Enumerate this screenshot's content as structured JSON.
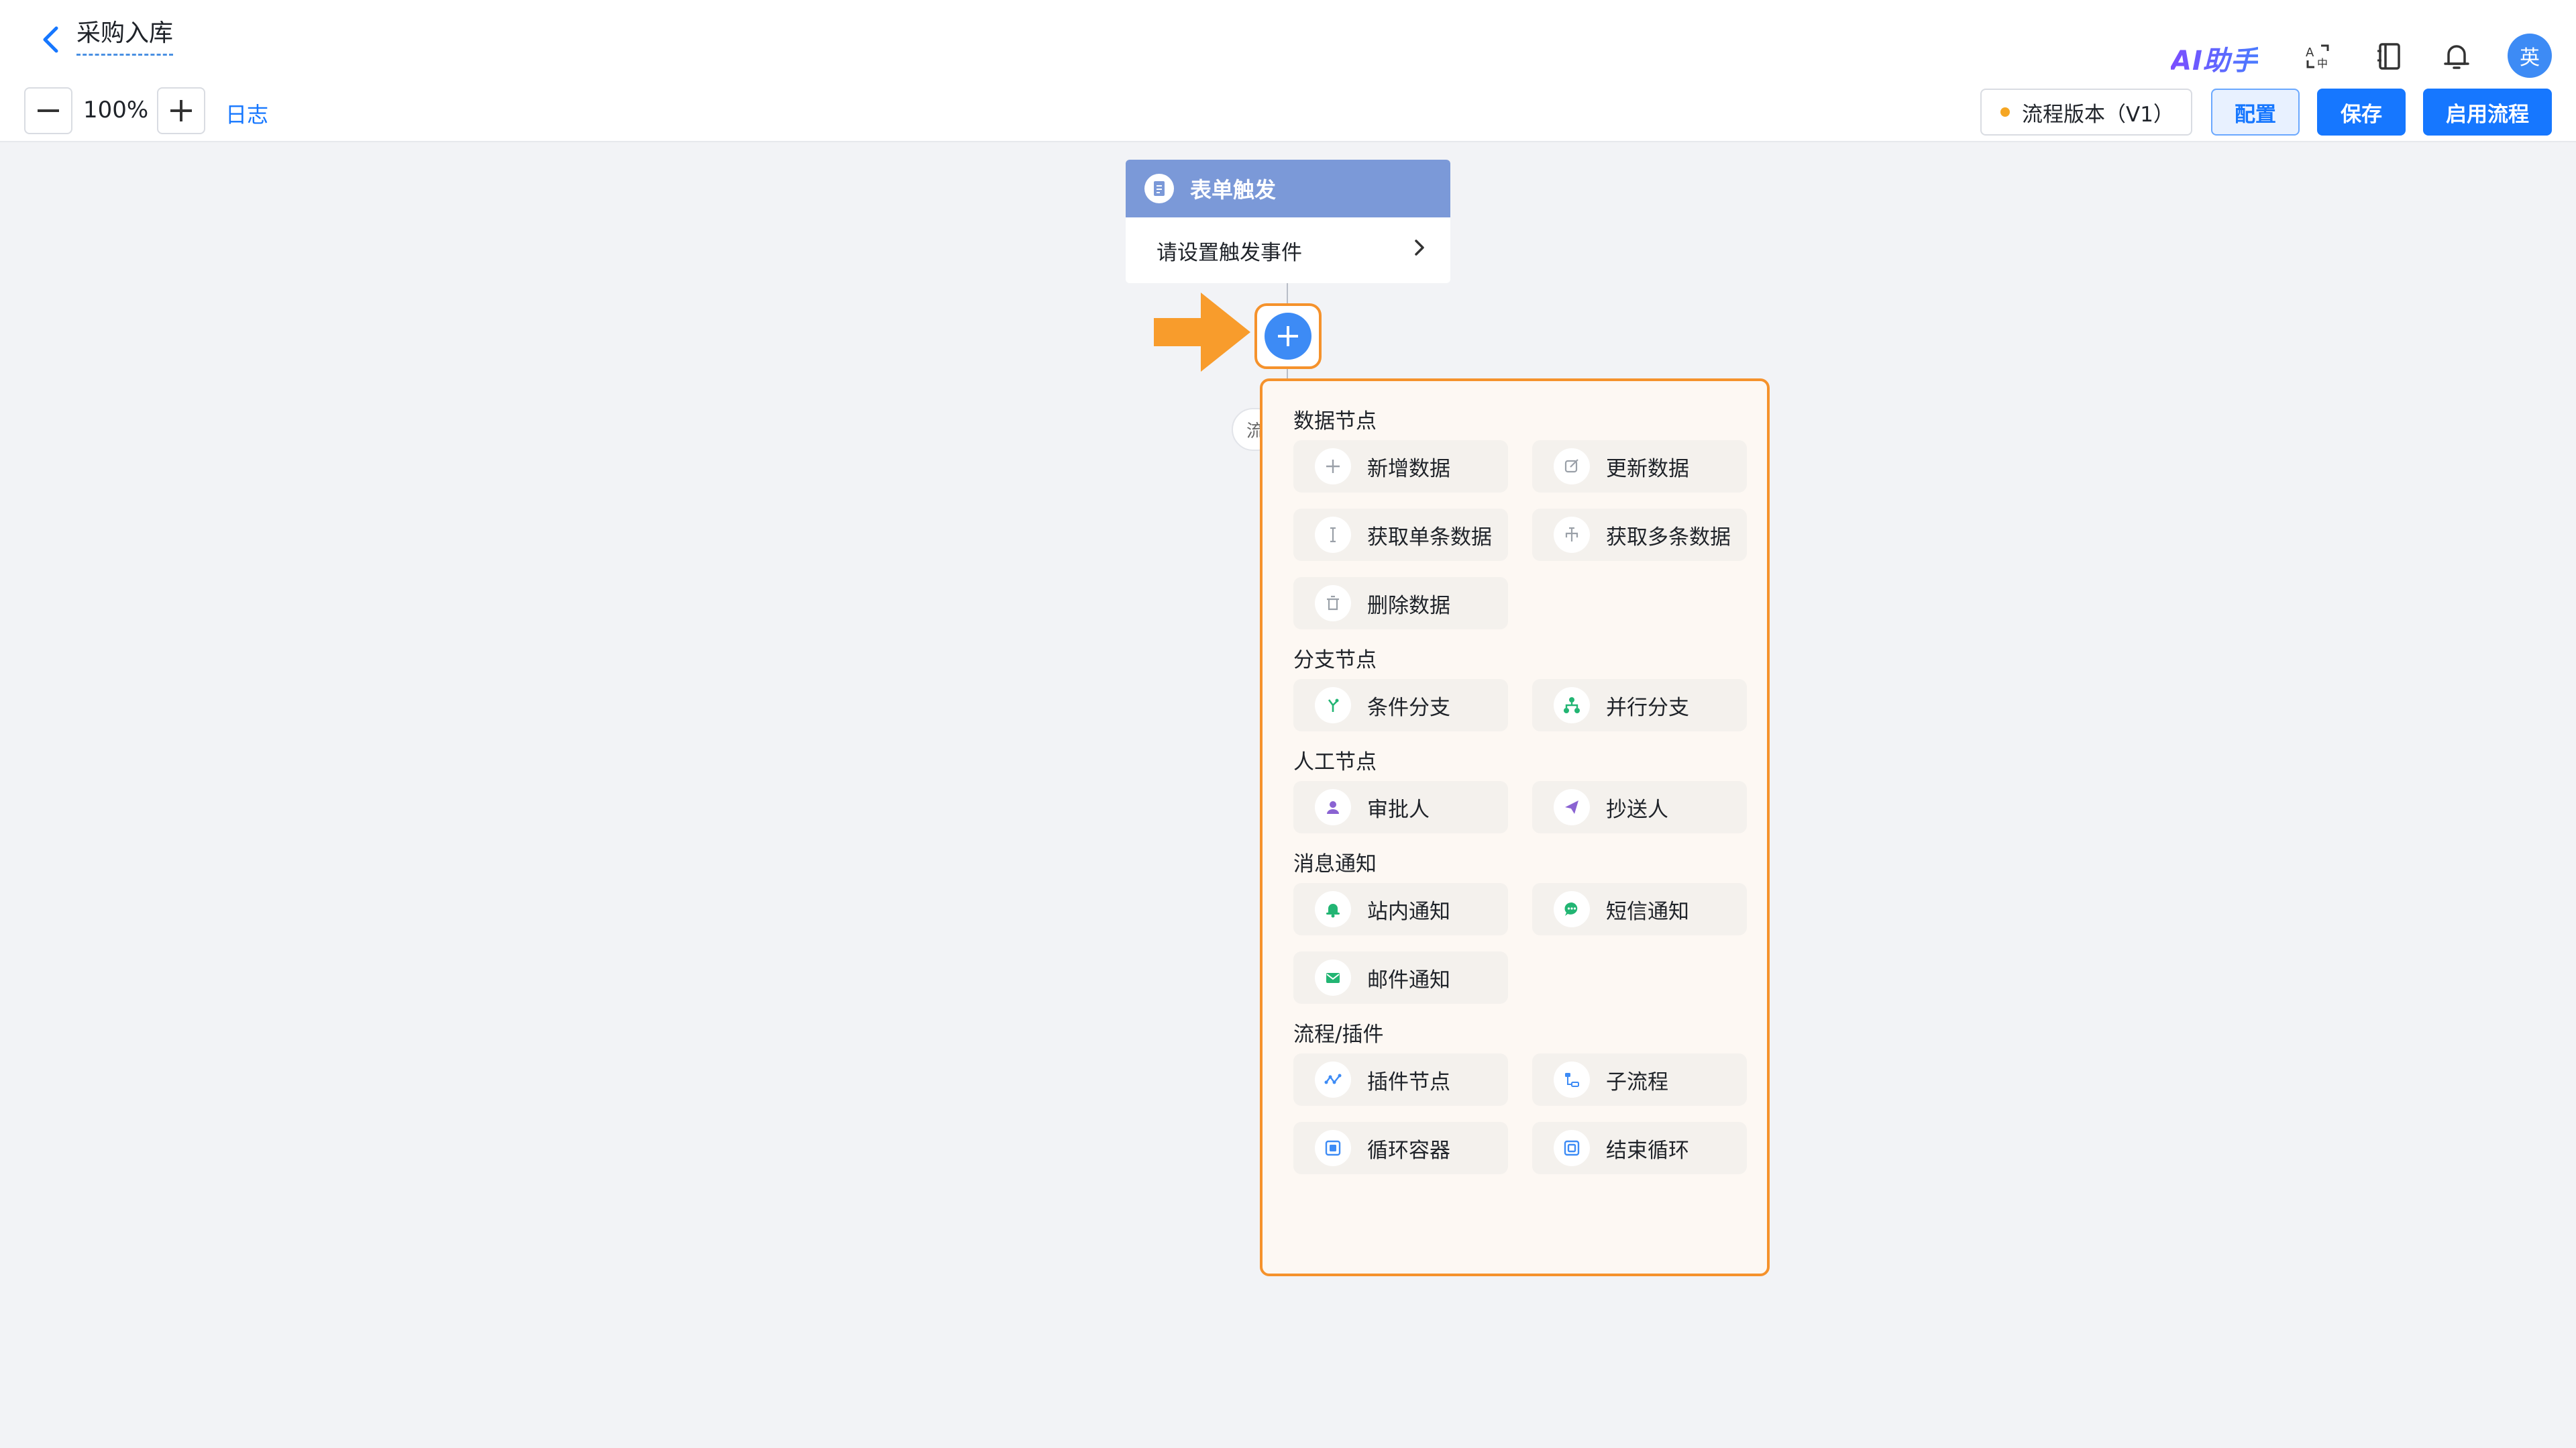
{
  "header": {
    "title": "采购入库",
    "ai_label": "AI助手",
    "avatar_text": "英"
  },
  "toolbar": {
    "zoom": "100%",
    "log_label": "日志",
    "version_label": "流程版本（V1）",
    "config_label": "配置",
    "save_label": "保存",
    "enable_label": "启用流程"
  },
  "canvas": {
    "trigger_title": "表单触发",
    "trigger_body": "请设置触发事件",
    "ghost_label": "流"
  },
  "menu": {
    "sections": [
      {
        "title": "数据节点",
        "items": [
          {
            "label": "新增数据",
            "icon": "plus-icon",
            "color": "#9aa0a8"
          },
          {
            "label": "更新数据",
            "icon": "edit-icon",
            "color": "#9aa0a8"
          },
          {
            "label": "获取单条数据",
            "icon": "single-data-icon",
            "color": "#9aa0a8"
          },
          {
            "label": "获取多条数据",
            "icon": "multi-data-icon",
            "color": "#9aa0a8"
          },
          {
            "label": "删除数据",
            "icon": "trash-icon",
            "color": "#9aa0a8"
          }
        ]
      },
      {
        "title": "分支节点",
        "items": [
          {
            "label": "条件分支",
            "icon": "condition-branch-icon",
            "color": "#22b573"
          },
          {
            "label": "并行分支",
            "icon": "parallel-branch-icon",
            "color": "#22b573"
          }
        ]
      },
      {
        "title": "人工节点",
        "items": [
          {
            "label": "审批人",
            "icon": "approver-icon",
            "color": "#8a63d2"
          },
          {
            "label": "抄送人",
            "icon": "send-icon",
            "color": "#8a63d2"
          }
        ]
      },
      {
        "title": "消息通知",
        "items": [
          {
            "label": "站内通知",
            "icon": "bell-icon",
            "color": "#22b573"
          },
          {
            "label": "短信通知",
            "icon": "sms-icon",
            "color": "#22b573"
          },
          {
            "label": "邮件通知",
            "icon": "mail-icon",
            "color": "#22b573"
          }
        ]
      },
      {
        "title": "流程/插件",
        "items": [
          {
            "label": "插件节点",
            "icon": "plugin-icon",
            "color": "#3d8bf5"
          },
          {
            "label": "子流程",
            "icon": "subprocess-icon",
            "color": "#3d8bf5"
          },
          {
            "label": "循环容器",
            "icon": "loop-container-icon",
            "color": "#3d8bf5"
          },
          {
            "label": "结束循环",
            "icon": "end-loop-icon",
            "color": "#3d8bf5"
          }
        ]
      }
    ]
  }
}
